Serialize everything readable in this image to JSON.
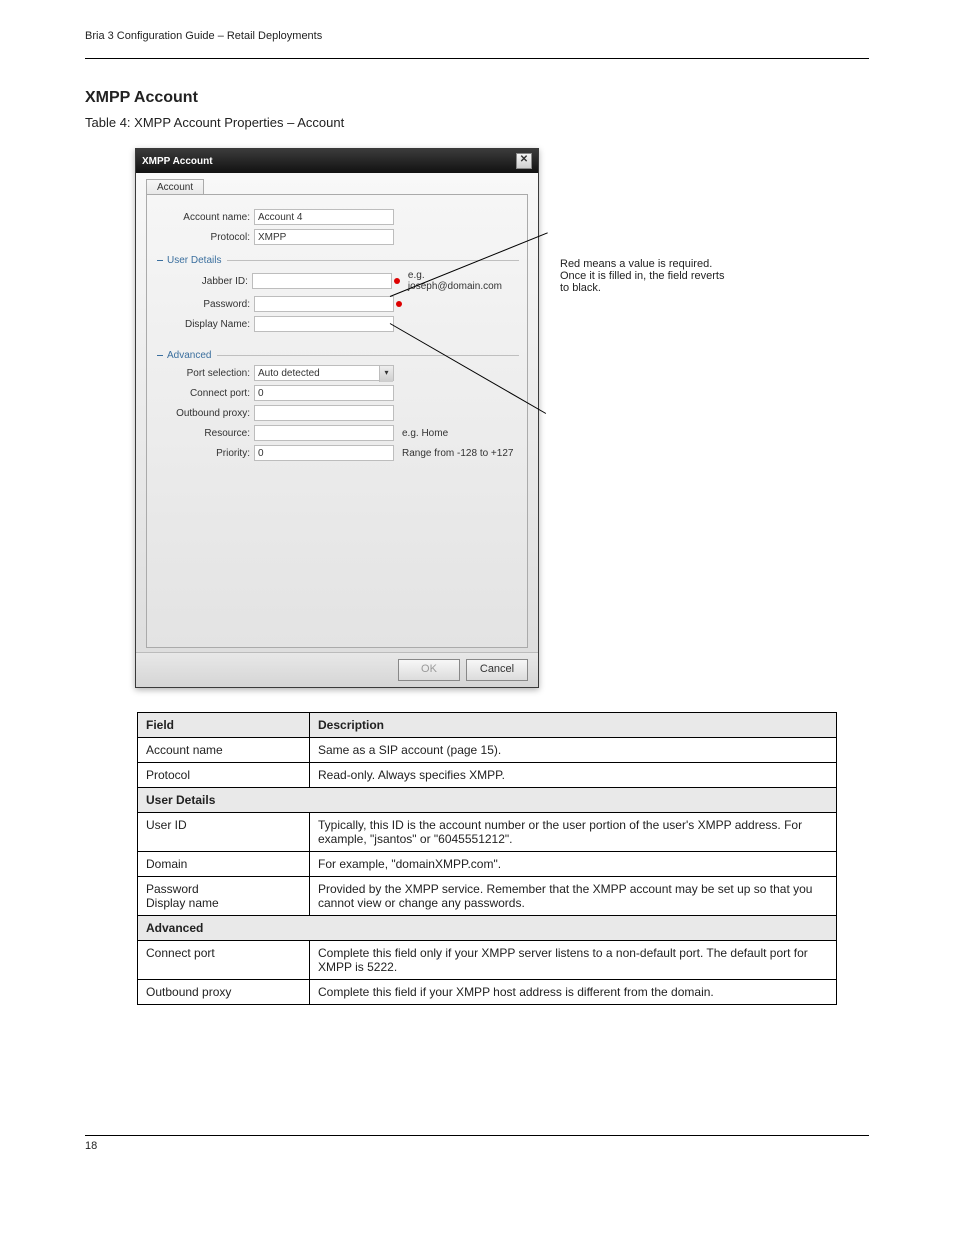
{
  "header": {
    "product": "Bria 3 Configuration Guide – Retail Deployments",
    "spacer": ""
  },
  "section": {
    "heading": "XMPP Account",
    "intro": "Table 4:  XMPP Account Properties – Account"
  },
  "dialog": {
    "title": "XMPP Account",
    "tab": "Account",
    "rows": {
      "account_name": {
        "label": "Account name:",
        "value": "Account 4"
      },
      "protocol": {
        "label": "Protocol:",
        "value": "XMPP"
      }
    },
    "user_details": {
      "legend": "User Details",
      "jabber_id": {
        "label": "Jabber ID:",
        "value": "",
        "hint": "e.g. joseph@domain.com"
      },
      "password": {
        "label": "Password:",
        "value": ""
      },
      "display_name": {
        "label": "Display Name:",
        "value": ""
      }
    },
    "advanced": {
      "legend": "Advanced",
      "port_selection": {
        "label": "Port selection:",
        "value": "Auto detected"
      },
      "connect_port": {
        "label": "Connect port:",
        "value": "0"
      },
      "outbound_proxy": {
        "label": "Outbound proxy:",
        "value": ""
      },
      "resource": {
        "label": "Resource:",
        "value": "",
        "hint": "e.g. Home"
      },
      "priority": {
        "label": "Priority:",
        "value": "0",
        "hint": "Range from -128 to +127"
      }
    },
    "buttons": {
      "ok": "OK",
      "cancel": "Cancel"
    }
  },
  "callout": "Red means a value is required. Once it is filled in, the field reverts to black.",
  "table": {
    "headers": {
      "field": "Field",
      "description": "Description"
    },
    "rows": [
      {
        "field": "Account name",
        "desc": "Same as a SIP account (page 15)."
      },
      {
        "field": "Protocol",
        "desc": "Read-only. Always specifies XMPP."
      }
    ],
    "section_user": "User Details",
    "user_rows": [
      {
        "field": "User ID",
        "desc": "Typically, this ID is the account number or the user portion of the user's XMPP address. For example, \"jsantos\" or \"6045551212\"."
      },
      {
        "field": "Domain",
        "desc": "For example, \"domainXMPP.com\"."
      },
      {
        "field": "Password\nDisplay name",
        "desc": "Provided by the XMPP service. Remember that the XMPP account may be set up so that you cannot view or change any passwords."
      }
    ],
    "section_adv": "Advanced",
    "adv_rows": [
      {
        "field": "Connect port",
        "desc": "Complete this field only if your XMPP server listens to a non-default port. The default port for XMPP is 5222."
      },
      {
        "field": "Outbound proxy",
        "desc": "Complete this field if your XMPP host address is different from the domain."
      }
    ]
  },
  "footer": {
    "page": "18"
  }
}
